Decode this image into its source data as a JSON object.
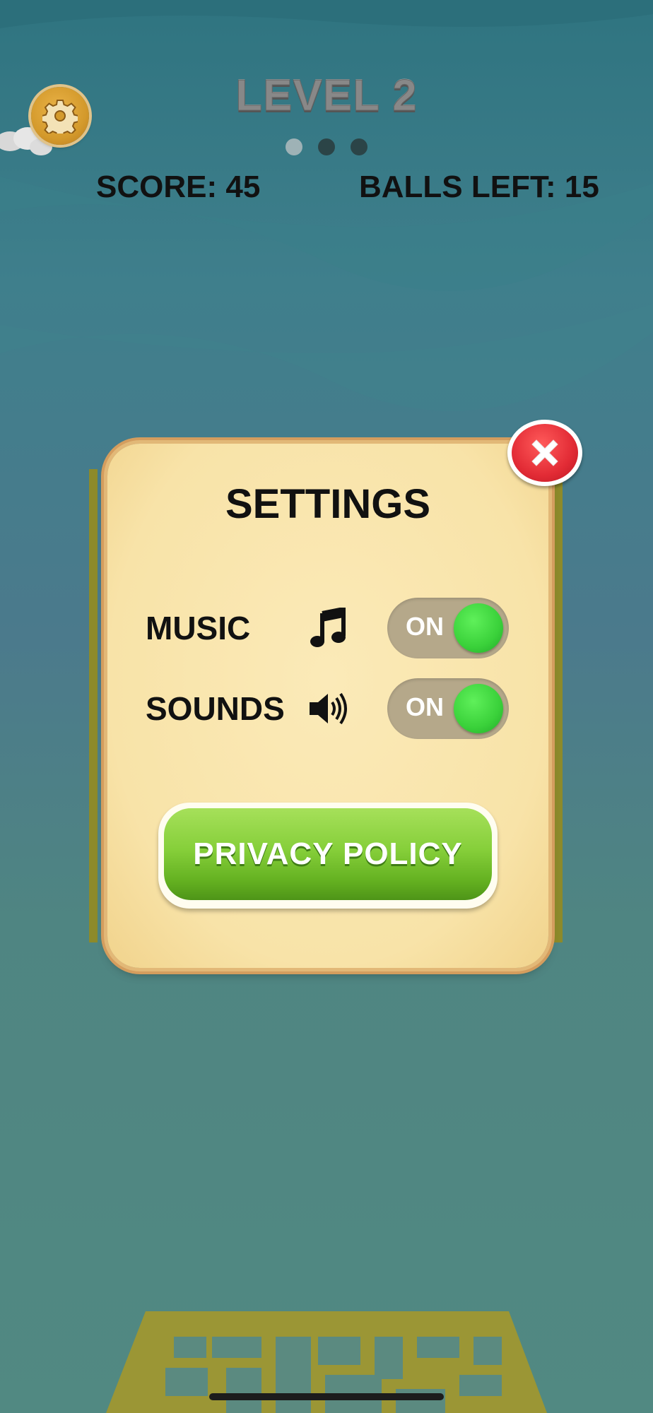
{
  "hud": {
    "level_title": "LEVEL 2",
    "score_text": "SCORE: 45",
    "balls_left_text": "BALLS LEFT: 15",
    "progress_dots": [
      {
        "state": "active"
      },
      {
        "state": "inactive"
      },
      {
        "state": "inactive"
      }
    ],
    "settings_icon": "gear-icon"
  },
  "settings_panel": {
    "title": "SETTINGS",
    "rows": [
      {
        "label": "MUSIC",
        "icon": "music-note-icon",
        "toggle_label": "ON",
        "enabled": true
      },
      {
        "label": "SOUNDS",
        "icon": "speaker-icon",
        "toggle_label": "ON",
        "enabled": true
      }
    ],
    "privacy_button_label": "PRIVACY POLICY",
    "close_icon": "close-icon"
  },
  "colors": {
    "panel_bg": "#f8e3a8",
    "toggle_on": "#3ad13a",
    "privacy_button": "#86cf3a",
    "close_button": "#e22b35"
  }
}
